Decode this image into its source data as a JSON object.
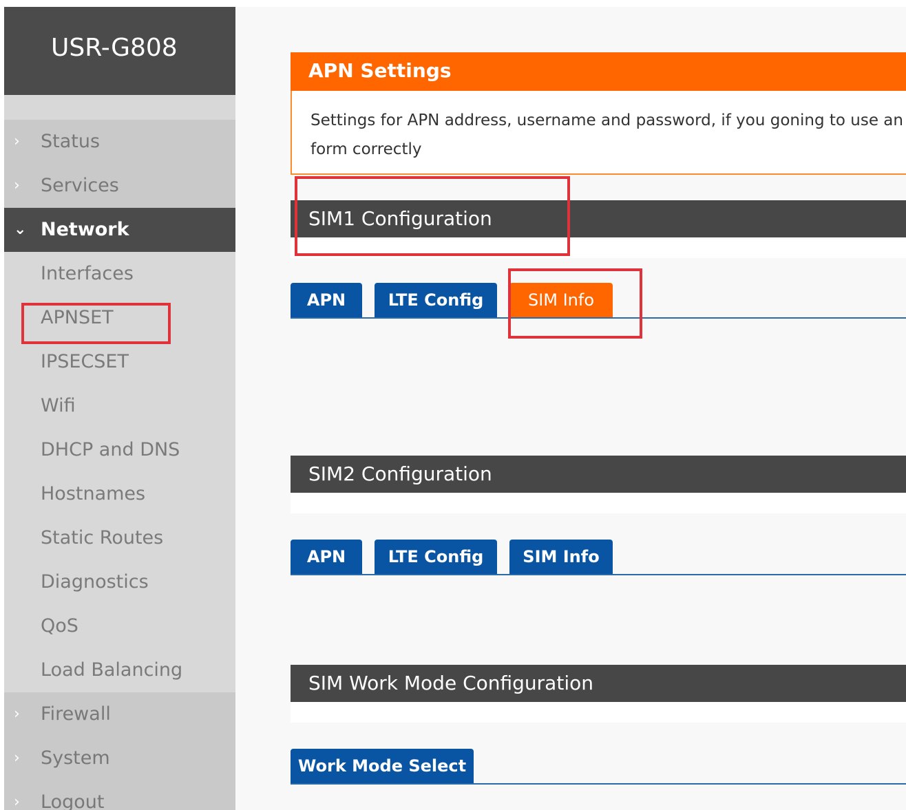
{
  "brand": "USR-G808",
  "nav": {
    "status": "Status",
    "services": "Services",
    "network": "Network",
    "sub": [
      "Interfaces",
      "APNSET",
      "IPSECSET",
      "Wifi",
      "DHCP and DNS",
      "Hostnames",
      "Static Routes",
      "Diagnostics",
      "QoS",
      "Load Balancing"
    ],
    "firewall": "Firewall",
    "system": "System",
    "logout": "Logout"
  },
  "apn_panel": {
    "title": "APN Settings",
    "desc_line1": "Settings for APN address, username and password, if you goning to use an",
    "desc_line2": "form correctly"
  },
  "sim1": {
    "title": "SIM1 Configuration",
    "tabs": [
      "APN",
      "LTE Config",
      "SIM Info"
    ],
    "active_tab": "SIM Info"
  },
  "sim2": {
    "title": "SIM2 Configuration",
    "tabs": [
      "APN",
      "LTE Config",
      "SIM Info"
    ]
  },
  "workmode": {
    "title": "SIM Work Mode Configuration",
    "tab": "Work Mode Select"
  },
  "colors": {
    "accent_orange": "#ff6600",
    "tab_blue": "#0a55a3",
    "dark_header": "#474747",
    "highlight_red": "#e0323a"
  }
}
